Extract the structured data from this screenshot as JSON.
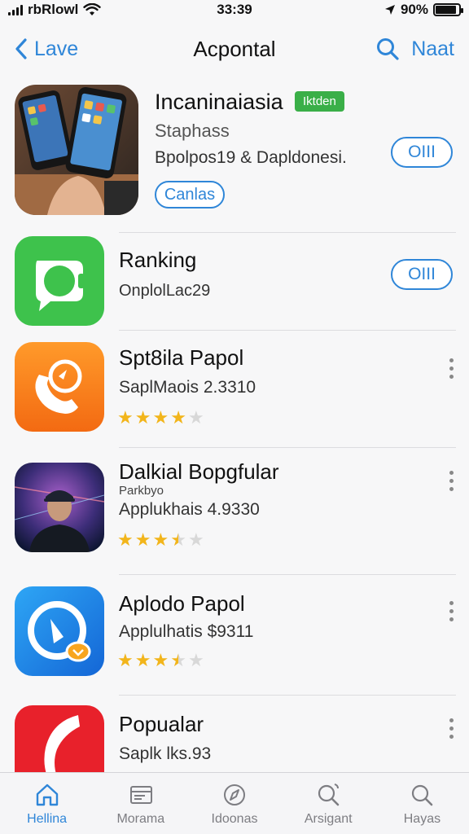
{
  "status_bar": {
    "carrier": "rbRlowl",
    "time": "33:39",
    "battery": "90%",
    "battery_level": 0.9
  },
  "nav": {
    "back_label": "Lave",
    "title": "Acpontal",
    "right_label": "Naat"
  },
  "featured": {
    "title": "Incaninaiasia",
    "badge": "Iktden",
    "subtitle": "Staphass",
    "meta": "Bpolpos19 & Dapldonesi.",
    "get_label": "OIII",
    "tag_label": "Canlas"
  },
  "rows": [
    {
      "title": "Ranking",
      "subtitle": "OnplolLac29",
      "action_label": "OIII"
    },
    {
      "title": "Spt8ila Papol",
      "subtitle": "SaplMaois 2.3310",
      "rating": 4
    },
    {
      "title": "Dalkial Bopgfular",
      "small": "Parkbyo",
      "subtitle": "Applukhais 4.9330",
      "rating": 3.5
    },
    {
      "title": "Aplodo Papol",
      "subtitle": "Applulhatis $9311",
      "rating": 3.5
    },
    {
      "title": "Popualar",
      "subtitle": "Saplk  lks.93"
    }
  ],
  "tabs": [
    {
      "label": "Hellina",
      "icon": "home-icon",
      "active": true
    },
    {
      "label": "Morama",
      "icon": "browser-icon",
      "active": false
    },
    {
      "label": "Idoonas",
      "icon": "compass-icon",
      "active": false
    },
    {
      "label": "Arsigant",
      "icon": "search-icon",
      "active": false
    },
    {
      "label": "Hayas",
      "icon": "search-icon",
      "active": false
    }
  ],
  "colors": {
    "accent": "#2f86d8",
    "badge_green": "#3aaf48",
    "star": "#f2b51b"
  }
}
